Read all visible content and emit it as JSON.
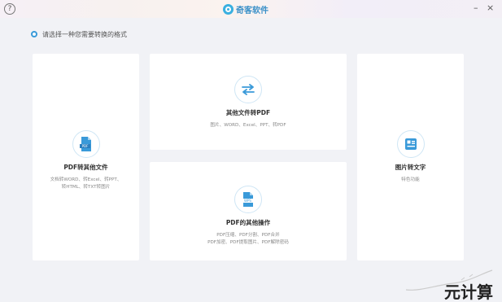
{
  "titlebar": {
    "help": "?",
    "app_name": "奇客软件",
    "minimize": "–",
    "close": "×"
  },
  "section": {
    "label": "请选择一种您需要转换的格式"
  },
  "cards": {
    "pdf_to_other": {
      "title": "PDF转其他文件",
      "desc_line1": "文档转WORD、转Excel、转PPT、",
      "desc_line2": "转HTML、转TXT转图片",
      "icon": "pdf-file-icon"
    },
    "other_to_pdf": {
      "title": "其他文件转PDF",
      "desc_line1": "图片、WORD、Excel、PPT、转PDF",
      "icon": "swap-arrows-icon"
    },
    "pdf_ops": {
      "title": "PDF的其他操作",
      "desc_line1": "PDF压缩、PDF分割、PDF合并",
      "desc_line2": "PDF加密、PDF提取图片、PDF解除密码",
      "icon": "wps-file-icon"
    },
    "image_to_text": {
      "title": "图片转文字",
      "desc_line1": "特色功能",
      "icon": "ocr-document-icon"
    }
  },
  "watermark": {
    "text": "元计算"
  },
  "colors": {
    "accent": "#3a9ad9",
    "background": "#f1f2f6",
    "card": "#ffffff"
  }
}
